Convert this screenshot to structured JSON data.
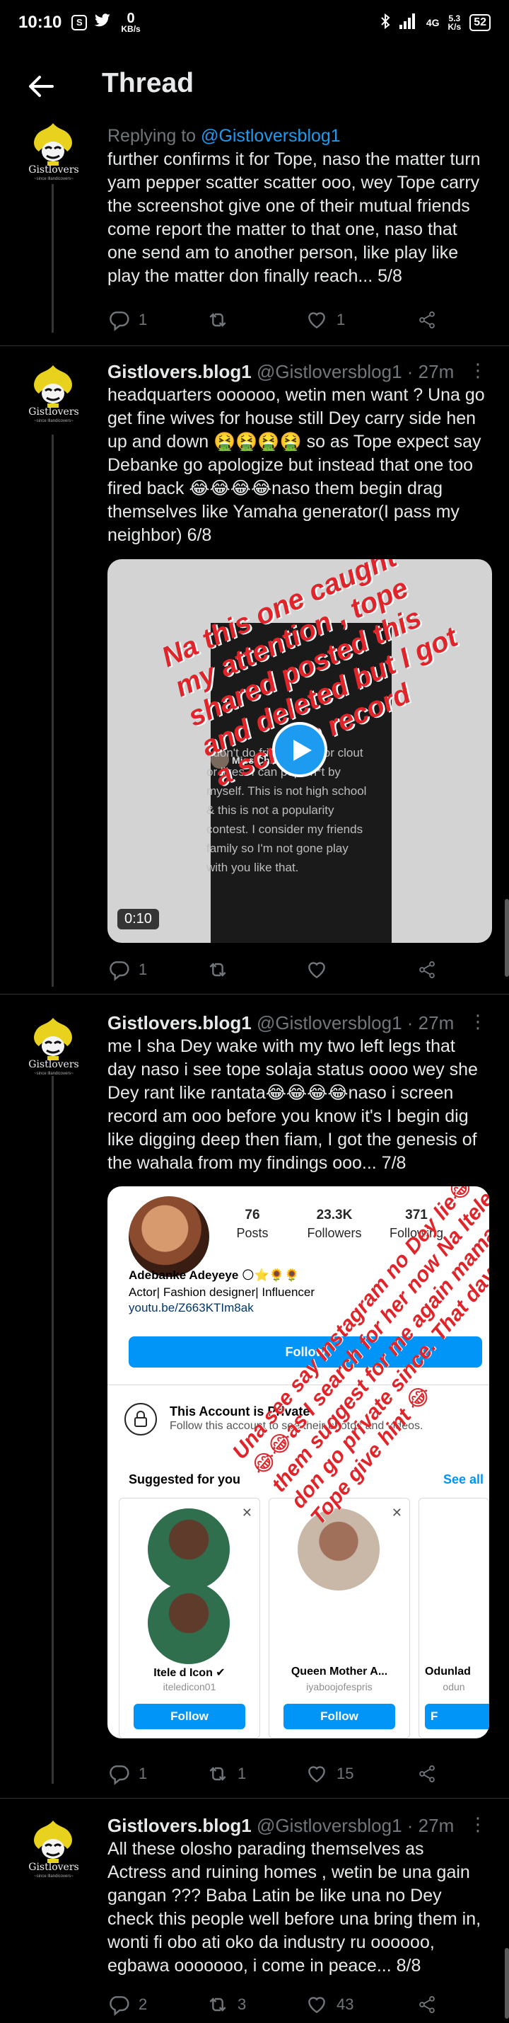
{
  "status_bar": {
    "time": "10:10",
    "speed_value": "0",
    "speed_unit": "KB/s",
    "network": "4G",
    "net_speed": "5.3",
    "net_speed_unit": "K/s",
    "battery": "52"
  },
  "header": {
    "title": "Thread"
  },
  "tweets": [
    {
      "replying_prefix": "Replying to ",
      "replying_to": "@Gistloversblog1",
      "text": "further confirms it for Tope, naso the matter turn yam pepper scatter scatter ooo, wey Tope carry the screenshot give one of their mutual friends come report the matter to that one, naso that one send am to another person, like play like play the matter don finally reach... 5/8",
      "replies": "1",
      "retweets": "",
      "likes": "1"
    },
    {
      "name": "Gistlovers.blog1",
      "handle": "@Gistloversblog1 · 27m",
      "text": "headquarters oooooo, wetin men want ? Una go get fine wives for house still Dey carry side hen up and down 🤮🤮🤮🤮 so as Tope expect say Debanke go apologize but instead that one too fired back 😂😂😂😂naso them begin drag themselves like Yamaha generator(I pass my neighbor) 6/8",
      "replies": "1",
      "retweets": "",
      "likes": "",
      "video": {
        "caption": "Na this one caught my attention , tope shared posted this and deleted but I got a screen record",
        "duration": "0:10",
        "poster_name": "Miss Chri",
        "poster_text": "I don't do friendships for clout or likes. I can pop sh*t by myself. This is not high school & this is not a popularity contest. I consider my friends family so I'm not gone play with you like that."
      }
    },
    {
      "name": "Gistlovers.blog1",
      "handle": "@Gistloversblog1 · 27m",
      "text": "me I sha Dey wake with my two left legs that day naso i see tope solaja status oooo wey she Dey rant like rantata😂😂😂😂naso i screen record am ooo before you know it's I begin dig like digging deep then fiam, I got the genesis of the wahala from my findings ooo... 7/8",
      "replies": "1",
      "retweets": "1",
      "likes": "15",
      "instagram": {
        "posts_num": "76",
        "posts_label": "Posts",
        "followers_num": "23.3K",
        "followers_label": "Followers",
        "following_num": "371",
        "following_label": "Following",
        "name": "Adebanke Adeyeye 🌕⭐🌻🌻",
        "bio": "Actor| Fashion designer| Influencer",
        "link": "youtu.be/Z663KTIm8ak",
        "follow": "Follow",
        "private_title": "This Account is Private",
        "private_sub": "Follow this account to see their photos and videos.",
        "suggested": "Suggested for you",
        "see_all": "See all",
        "cards": [
          {
            "name": "Itele d Icon ✔",
            "user": "iteledicon01",
            "follow": "Follow"
          },
          {
            "name": "Queen Mother A...",
            "user": "iyaboojofespris",
            "follow": "Follow"
          },
          {
            "name": "Odunlad",
            "user": "odun",
            "follow": "F"
          }
        ],
        "overlay": "Una see say Instagram no Dey lie😂😂😂as I search for her now Na Itele them suggest for me again mama don go private since. That day wey Tope give hint 😂"
      }
    },
    {
      "name": "Gistlovers.blog1",
      "handle": "@Gistloversblog1 · 27m",
      "text": "All these olosho parading themselves as Actress and ruining homes , wetin be una gain gangan ??? Baba Latin be like una no Dey check this people well before una bring them in, wonti fi obo ati oko da industry ru oooooo, egbawa ooooooo, i come in peace... 8/8",
      "replies": "2",
      "retweets": "3",
      "likes": "43"
    }
  ],
  "avatar_label": "Gistlovers",
  "avatar_tagline": "~since lllandicovers~",
  "colors": {
    "background": "#000000",
    "accent": "#1d9bf0",
    "muted": "#71767b",
    "thread_line": "#333639"
  }
}
